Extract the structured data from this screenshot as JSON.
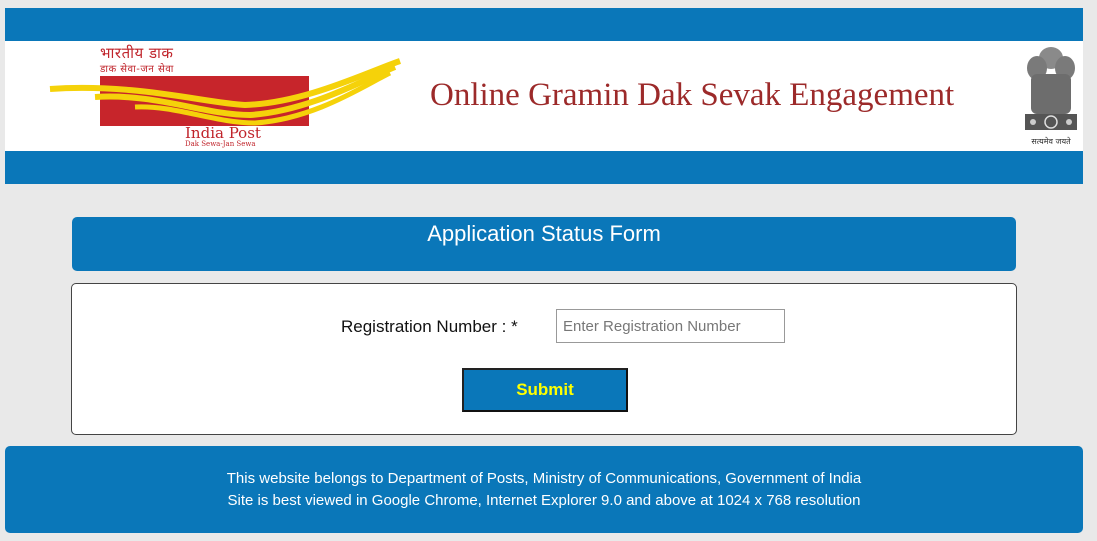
{
  "header": {
    "logo": {
      "hindi_title": "भारतीय डाक",
      "hindi_tagline": "डाक सेवा-जन सेवा",
      "name": "India Post",
      "tagline": "Dak Sewa-Jan Sewa"
    },
    "title": "Online Gramin Dak Sevak Engagement",
    "emblem_caption": "सत्यमेव जयते"
  },
  "form": {
    "title": "Application Status Form",
    "registration_label": "Registration Number : *",
    "registration_placeholder": "Enter Registration Number",
    "registration_value": "",
    "submit_label": "Submit"
  },
  "footer": {
    "line1": "This website belongs to Department of Posts, Ministry of Communications, Government of India",
    "line2": "Site is best viewed in Google Chrome, Internet Explorer 9.0 and above at 1024 x 768 resolution"
  },
  "colors": {
    "primary_blue": "#0a77b9",
    "title_red": "#9c2a2a",
    "logo_red": "#c7252b",
    "logo_yellow": "#f5d20a",
    "button_text": "#ffff00"
  }
}
